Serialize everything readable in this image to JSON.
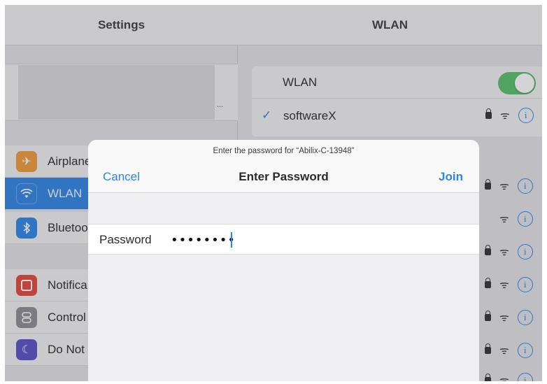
{
  "left_pane": {
    "title": "Settings",
    "profile_ellipsis": "...",
    "items": [
      {
        "label": "Airplane",
        "icon": "airplane-icon",
        "color": "#f19a37",
        "top": 0
      },
      {
        "label": "WLAN",
        "icon": "wifi-icon",
        "color": "#2f84e6",
        "selected": true
      },
      {
        "label": "Bluetoo",
        "icon": "bluetooth-icon",
        "color": "#2f84e6"
      },
      {
        "label": "Notifica",
        "icon": "notifications-icon",
        "color": "#e6473a"
      },
      {
        "label": "Control",
        "icon": "control-center-icon",
        "color": "#8e8e93"
      },
      {
        "label": "Do Not",
        "icon": "moon-icon",
        "color": "#5b4fc7"
      }
    ]
  },
  "right_pane": {
    "title": "WLAN",
    "wlan_label": "WLAN",
    "wlan_enabled": true,
    "current_network": "softwareX"
  },
  "dialog": {
    "prompt": "Enter the password for “Abilix-C-13948”",
    "cancel_label": "Cancel",
    "title": "Enter Password",
    "join_label": "Join",
    "password_label": "Password",
    "password_value": "••••••••"
  },
  "colors": {
    "accent": "#2f84e6",
    "toggle_on": "#56c16a"
  }
}
